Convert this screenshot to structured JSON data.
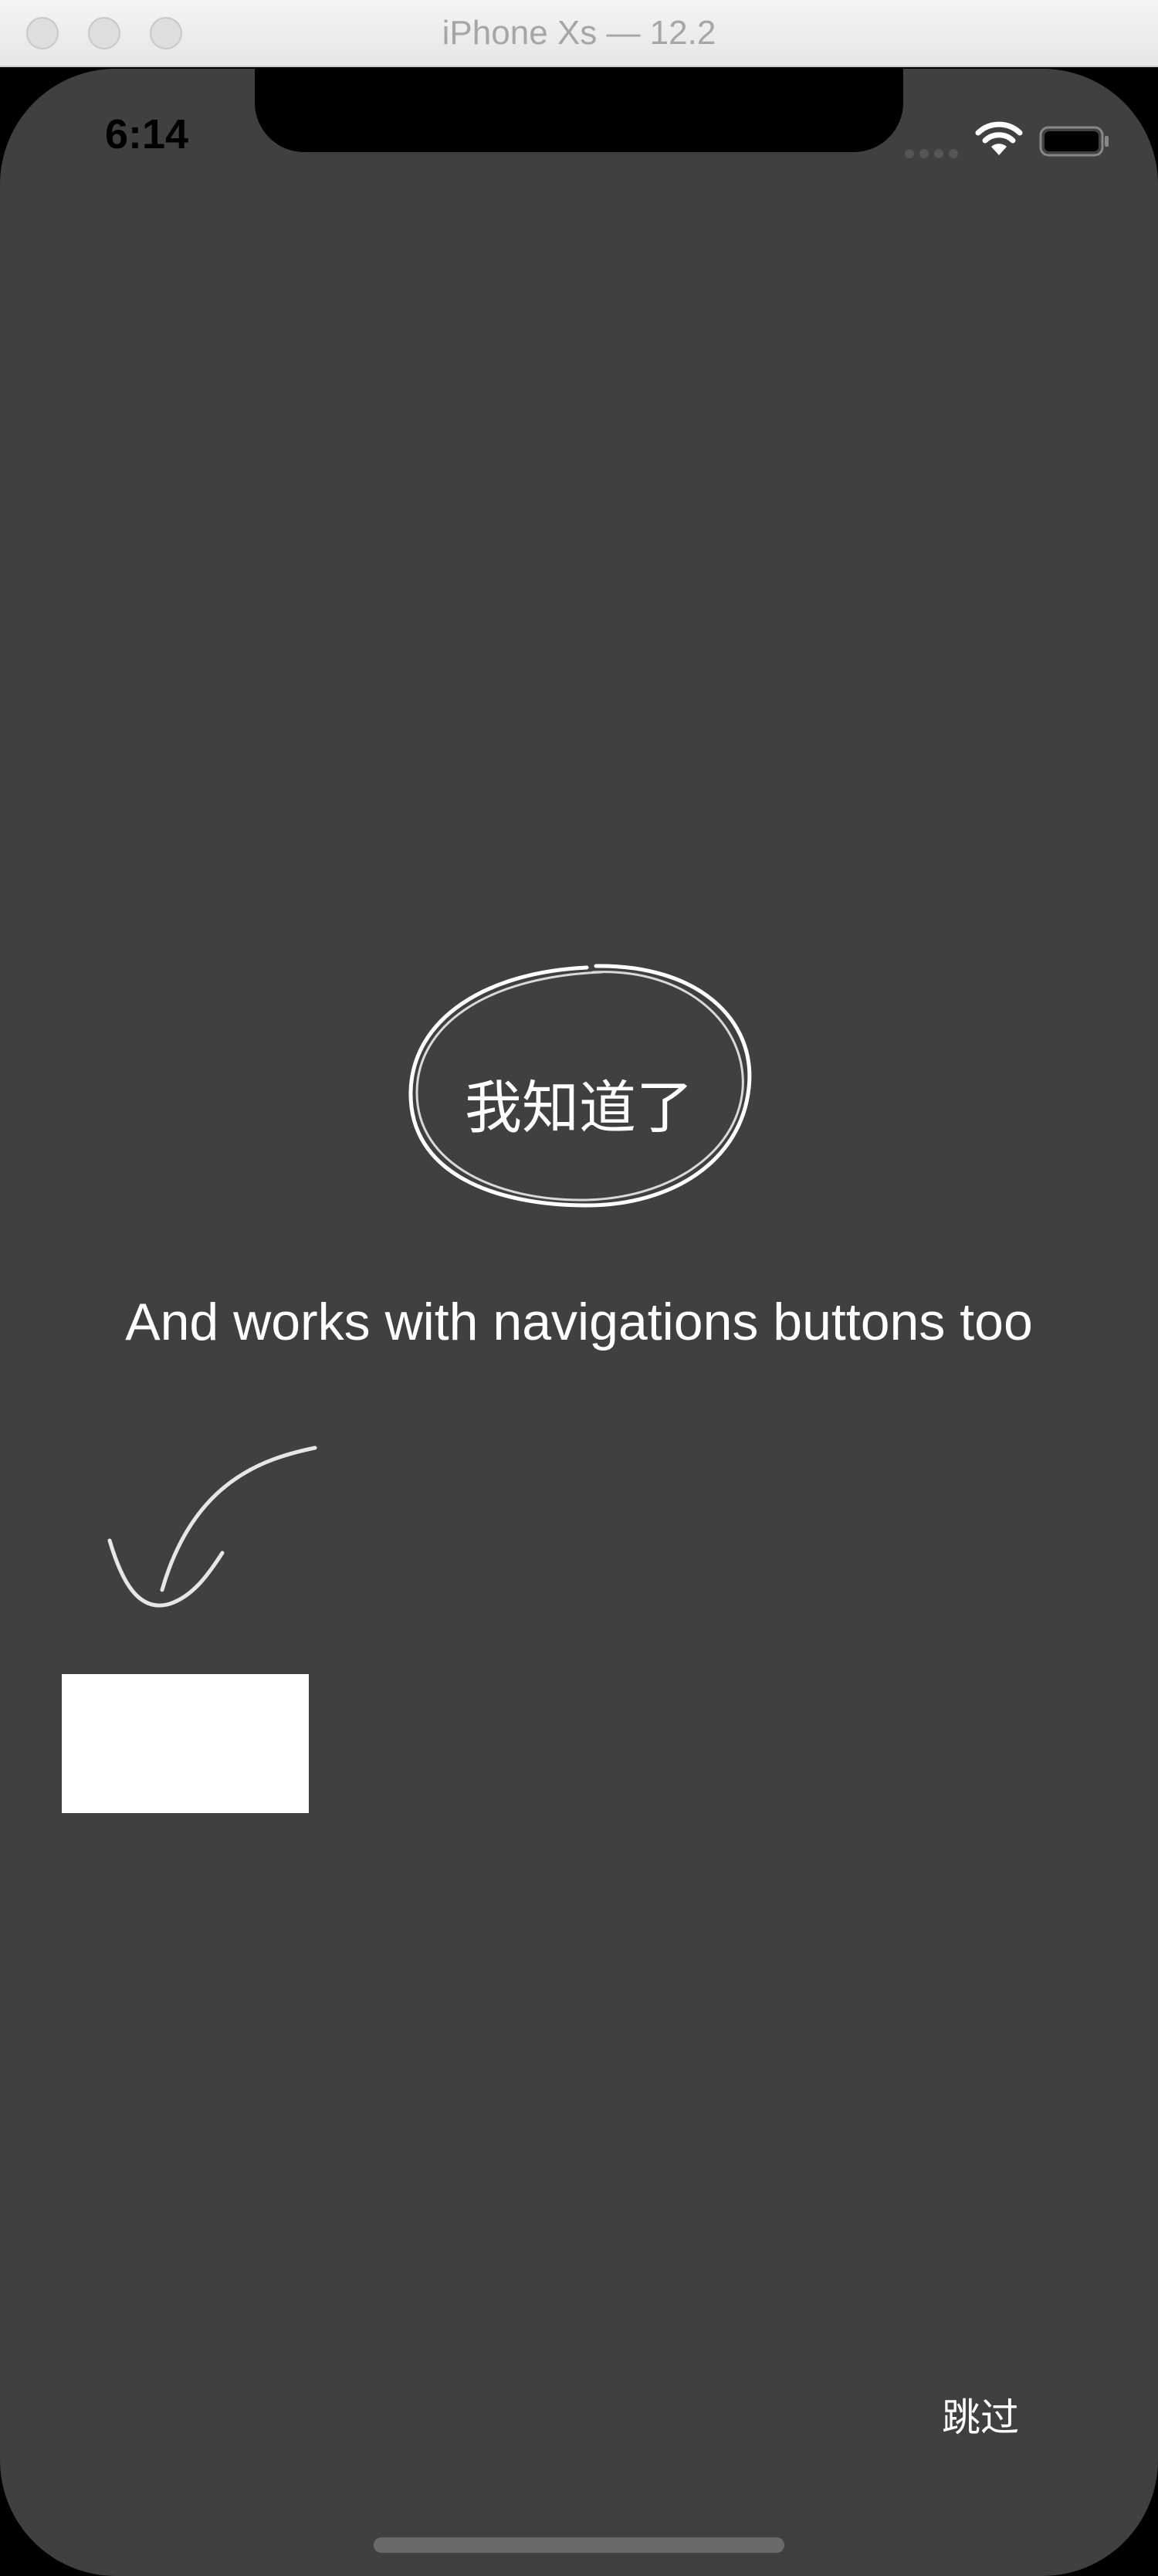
{
  "window": {
    "title": "iPhone Xs — 12.2"
  },
  "status_bar": {
    "time": "6:14",
    "icons": [
      "signal-dots-icon",
      "wifi-icon",
      "battery-icon"
    ]
  },
  "overlay": {
    "button_label": "我知道了",
    "message": "And works with navigations buttons too",
    "skip_label": "跳过",
    "colors": {
      "backdrop": "#404040",
      "foreground": "#ffffff"
    }
  }
}
